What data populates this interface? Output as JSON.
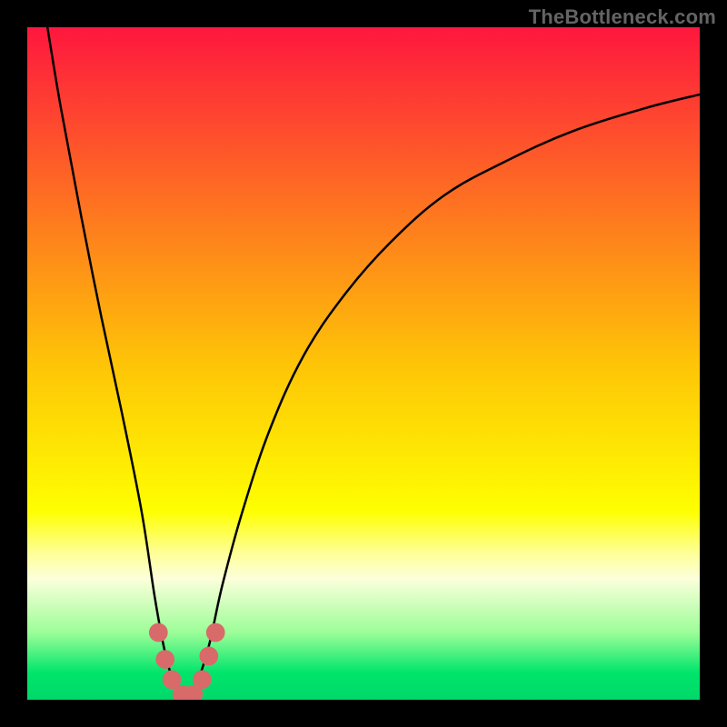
{
  "watermark": "TheBottleneck.com",
  "chart_data": {
    "type": "line",
    "title": "",
    "xlabel": "",
    "ylabel": "",
    "xlim": [
      0,
      100
    ],
    "ylim": [
      0,
      100
    ],
    "grid": false,
    "legend": false,
    "background": {
      "type": "vertical-gradient",
      "stops": [
        {
          "pos": 0.0,
          "color": "#fe173e"
        },
        {
          "pos": 0.5,
          "color": "#fec407"
        },
        {
          "pos": 0.72,
          "color": "#feff01"
        },
        {
          "pos": 0.78,
          "color": "#feff93"
        },
        {
          "pos": 0.82,
          "color": "#fcffdb"
        },
        {
          "pos": 0.9,
          "color": "#9cfe98"
        },
        {
          "pos": 0.96,
          "color": "#00e56b"
        },
        {
          "pos": 1.0,
          "color": "#00d869"
        }
      ]
    },
    "series": [
      {
        "name": "bottleneck-curve",
        "color": "#000000",
        "x": [
          3,
          5,
          8,
          11,
          14,
          17,
          19,
          20.5,
          22,
          23.5,
          25,
          27,
          29,
          32,
          36,
          41,
          47,
          54,
          62,
          71,
          81,
          92,
          100
        ],
        "values": [
          100,
          88,
          72,
          57,
          43,
          28,
          15,
          7,
          2,
          0.5,
          2,
          8,
          17,
          28,
          40,
          51,
          60,
          68,
          75,
          80,
          84.5,
          88,
          90
        ]
      }
    ],
    "markers": {
      "name": "trough-markers",
      "color": "#d86a6a",
      "radius_pct": 1.4,
      "points": [
        {
          "x": 19.5,
          "y": 10
        },
        {
          "x": 20.5,
          "y": 6
        },
        {
          "x": 21.5,
          "y": 3
        },
        {
          "x": 23.0,
          "y": 0.8
        },
        {
          "x": 24.7,
          "y": 0.8
        },
        {
          "x": 26.0,
          "y": 3
        },
        {
          "x": 27.0,
          "y": 6.5
        },
        {
          "x": 28.0,
          "y": 10
        }
      ]
    }
  }
}
